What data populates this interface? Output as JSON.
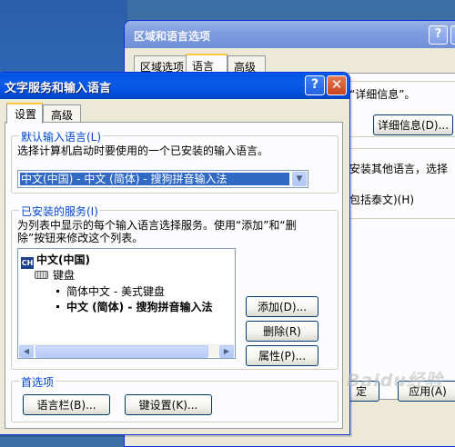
{
  "back_window": {
    "title": "区域和语言选项",
    "help_glyph": "?",
    "close_glyph": "×",
    "tabs": [
      {
        "label": "区域选项",
        "active": false
      },
      {
        "label": "语言",
        "active": true
      },
      {
        "label": "高级",
        "active": false
      }
    ],
    "line1": "“详细信息”。",
    "details_button": "详细信息(D)...",
    "line2": "安装其他语言，选择",
    "line3": "包括泰文)(H)",
    "apply_button": "应用(A)",
    "ok_partial": "定"
  },
  "front_window": {
    "title": "文字服务和输入语言",
    "help_glyph": "?",
    "close_glyph": "✕",
    "tabs": [
      {
        "label": "设置",
        "active": true
      },
      {
        "label": "高级",
        "active": false
      }
    ],
    "default_input": {
      "title": "默认输入语言(L)",
      "description": "选择计算机启动时要使用的一个已安装的输入语言。",
      "selected": "中文(中国) - 中文 (简体) - 搜狗拼音输入法"
    },
    "installed_services": {
      "title": "已安装的服务(I)",
      "description_line1": "为列表中显示的每个输入语言选择服务。使用“添加”和“删",
      "description_line2": "除”按钮来修改这个列表。",
      "tree": {
        "language_badge": "CH",
        "language": "中文(中国)",
        "category": "键盘",
        "services": [
          {
            "label": "简体中文 - 美式键盘",
            "bold": false
          },
          {
            "label": "中文 (简体) - 搜狗拼音输入法",
            "bold": true
          }
        ]
      },
      "buttons": {
        "add": "添加(D)...",
        "remove": "删除(R)",
        "properties": "属性(P)..."
      }
    },
    "preferences": {
      "title": "首选项",
      "language_bar_button": "语言栏(B)...",
      "key_settings_button": "键设置(K)..."
    }
  },
  "watermark": "Baidu经验"
}
